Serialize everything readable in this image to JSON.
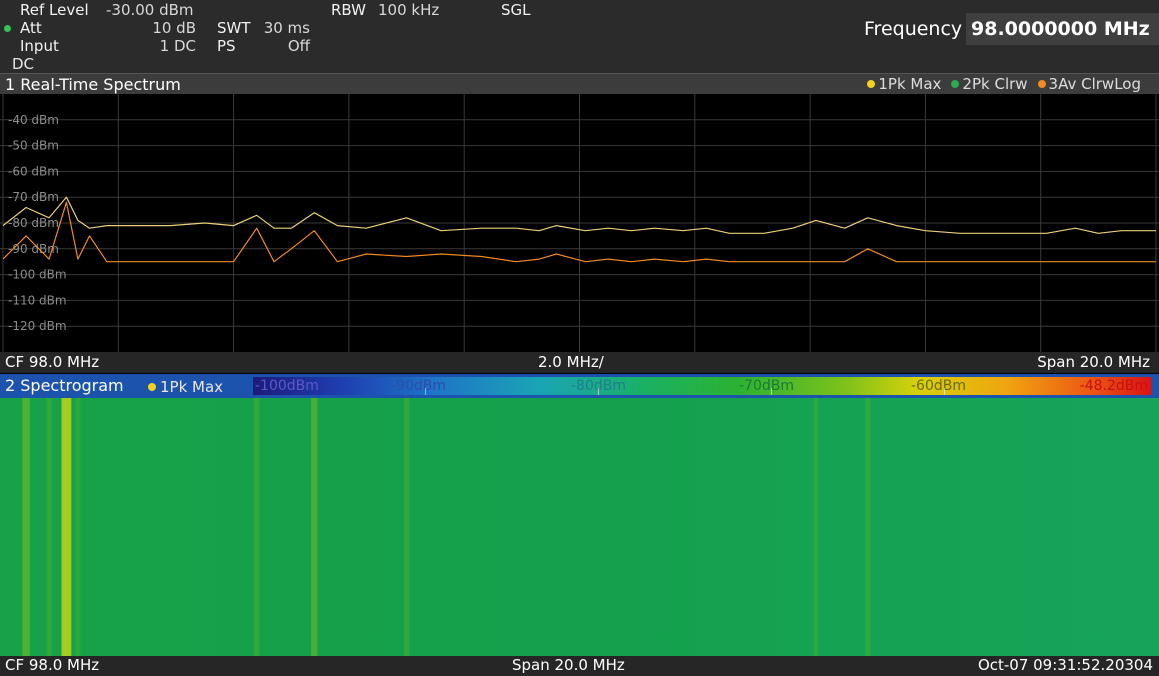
{
  "header": {
    "ref_level_label": "Ref Level",
    "ref_level_value": "-30.00 dBm",
    "att_label": "Att",
    "att_value": "10 dB",
    "input_label": "Input",
    "input_value": "1 DC",
    "dc_label": "DC",
    "swt_label": "SWT",
    "swt_value": "30 ms",
    "ps_label": "PS",
    "ps_value": "Off",
    "rbw_label": "RBW",
    "rbw_value": "100 kHz",
    "mode": "SGL",
    "frequency_label": "Frequency",
    "frequency_value": "98.0000000 MHz"
  },
  "window1": {
    "title": "1 Real-Time Spectrum",
    "legend": [
      {
        "label": "1Pk Max",
        "color": "#f2d21e"
      },
      {
        "label": "2Pk Clrw",
        "color": "#2fa84f"
      },
      {
        "label": "3Av ClrwLog",
        "color": "#f08a24"
      }
    ],
    "footer_left": "CF 98.0 MHz",
    "footer_center": "2.0 MHz/",
    "footer_right": "Span 20.0 MHz"
  },
  "window2": {
    "title": "2 Spectrogram",
    "trace_label": "1Pk Max",
    "trace_color": "#f2d21e",
    "colorbar_labels": [
      "-100dBm",
      "-90dBm",
      "-80dBm",
      "-70dBm",
      "-60dBm",
      "-48.2dBm"
    ],
    "footer_left": "CF 98.0 MHz",
    "footer_center": "Span 20.0 MHz",
    "footer_right": "Oct-07 09:31:52.20304"
  },
  "chart_data": {
    "type": "line",
    "x": [
      88.0,
      88.4,
      88.8,
      89.1,
      89.3,
      89.5,
      89.8,
      90.3,
      90.9,
      91.5,
      92.0,
      92.4,
      92.7,
      93.0,
      93.4,
      93.8,
      94.3,
      95.0,
      95.6,
      96.3,
      96.9,
      97.3,
      97.6,
      98.1,
      98.5,
      98.9,
      99.3,
      99.8,
      100.2,
      100.6,
      101.2,
      101.7,
      102.1,
      102.6,
      103.0,
      103.5,
      104.0,
      104.6,
      105.1,
      105.6,
      106.1,
      106.6,
      107.0,
      107.4,
      107.8,
      108.0
    ],
    "ylim": [
      -130,
      -30
    ],
    "y_axis_labels": [
      "-40 dBm",
      "-50 dBm",
      "-60 dBm",
      "-70 dBm",
      "-80 dBm",
      "-90 dBm",
      "-100 dBm",
      "-110 dBm",
      "-120 dBm"
    ],
    "series": [
      {
        "name": "1Pk Max",
        "color": "#e9cf78",
        "values": [
          -81,
          -74,
          -78,
          -70,
          -79,
          -82,
          -81,
          -81,
          -81,
          -80,
          -81,
          -77,
          -82,
          -82,
          -76,
          -81,
          -82,
          -78,
          -83,
          -82,
          -82,
          -83,
          -81,
          -83,
          -82,
          -83,
          -82,
          -83,
          -82,
          -84,
          -84,
          -82,
          -79,
          -82,
          -78,
          -81,
          -83,
          -84,
          -84,
          -84,
          -84,
          -82,
          -84,
          -83,
          -83,
          -83
        ]
      },
      {
        "name": "3Av ClrwLog",
        "color": "#f08a24",
        "values": [
          -94,
          -85,
          -94,
          -72,
          -94,
          -85,
          -95,
          -95,
          -95,
          -95,
          -95,
          -82,
          -95,
          -90,
          -83,
          -95,
          -92,
          -93,
          -92,
          -93,
          -95,
          -94,
          -92,
          -95,
          -94,
          -95,
          -94,
          -95,
          -94,
          -95,
          -95,
          -95,
          -95,
          -95,
          -90,
          -95,
          -95,
          -95,
          -95,
          -95,
          -95,
          -95,
          -95,
          -95,
          -95,
          -95
        ]
      }
    ]
  }
}
